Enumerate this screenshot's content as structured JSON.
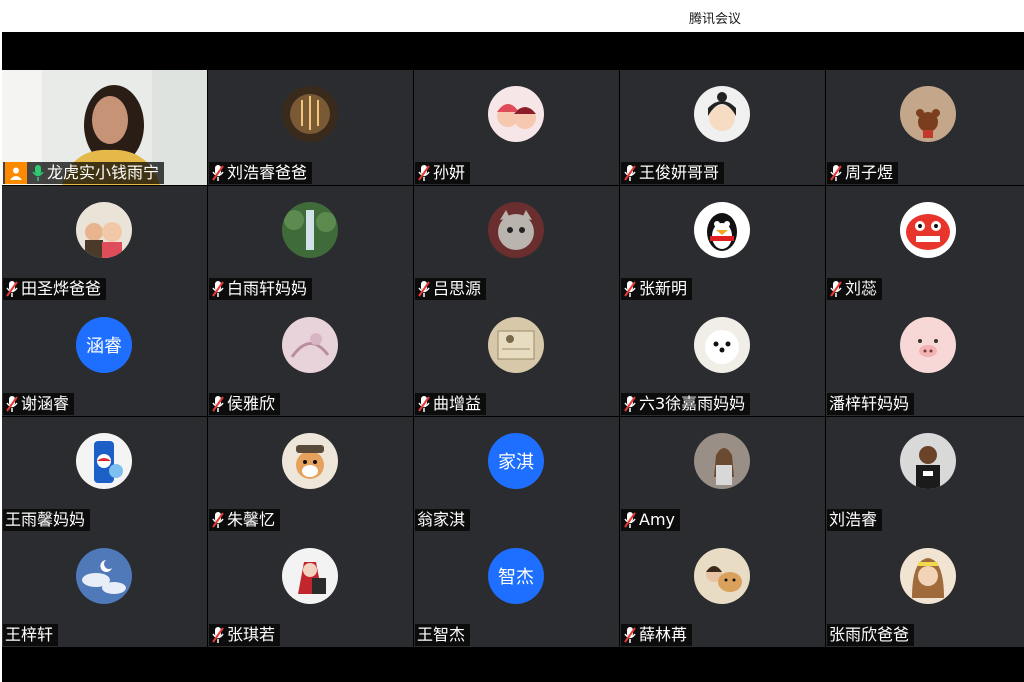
{
  "window": {
    "title": "腾讯会议"
  },
  "participants": [
    {
      "name": "龙虎实小钱雨宁",
      "mic": "on",
      "video": true,
      "host": true
    },
    {
      "name": "刘浩睿爸爸",
      "mic": "muted",
      "avatar": "avatar-lights"
    },
    {
      "name": "孙妍",
      "mic": "muted",
      "avatar": "avatar-cartoon-couple"
    },
    {
      "name": "王俊妍哥哥",
      "mic": "muted",
      "avatar": "avatar-anime-boy"
    },
    {
      "name": "周子煜",
      "mic": "muted",
      "avatar": "avatar-bear"
    },
    {
      "name": "田圣烨爸爸",
      "mic": "muted",
      "avatar": "avatar-family-photo"
    },
    {
      "name": "白雨轩妈妈",
      "mic": "muted",
      "avatar": "avatar-waterfall"
    },
    {
      "name": "吕思源",
      "mic": "muted",
      "avatar": "avatar-cat"
    },
    {
      "name": "张新明",
      "mic": "muted",
      "avatar": "avatar-penguin"
    },
    {
      "name": "刘蕊",
      "mic": "muted",
      "avatar": "avatar-lion-dance"
    },
    {
      "name": "谢涵睿",
      "mic": "muted",
      "avatar_text": "涵睿"
    },
    {
      "name": "侯雅欣",
      "mic": "muted",
      "avatar": "avatar-pink-sketch"
    },
    {
      "name": "曲增益",
      "mic": "muted",
      "avatar": "avatar-box"
    },
    {
      "name": "六3徐嘉雨妈妈",
      "mic": "muted",
      "avatar": "avatar-dog-white"
    },
    {
      "name": "潘梓轩妈妈",
      "mic": "none",
      "avatar": "avatar-pig"
    },
    {
      "name": "王雨馨妈妈",
      "mic": "none",
      "avatar": "avatar-pepsi"
    },
    {
      "name": "朱馨忆",
      "mic": "muted",
      "avatar": "avatar-shiba-hat"
    },
    {
      "name": "翁家淇",
      "mic": "none",
      "avatar_text": "家淇"
    },
    {
      "name": "Amy",
      "mic": "muted",
      "avatar": "avatar-girl-rocks"
    },
    {
      "name": "刘浩睿",
      "mic": "none",
      "avatar": "avatar-basketball"
    },
    {
      "name": "王梓轩",
      "mic": "none",
      "avatar": "avatar-clouds"
    },
    {
      "name": "张琪若",
      "mic": "muted",
      "avatar": "avatar-anime-red"
    },
    {
      "name": "王智杰",
      "mic": "none",
      "avatar_text": "智杰"
    },
    {
      "name": "薛林苒",
      "mic": "muted",
      "avatar": "avatar-dog-girl"
    },
    {
      "name": "张雨欣爸爸",
      "mic": "none",
      "avatar": "avatar-girl-portrait"
    }
  ]
}
